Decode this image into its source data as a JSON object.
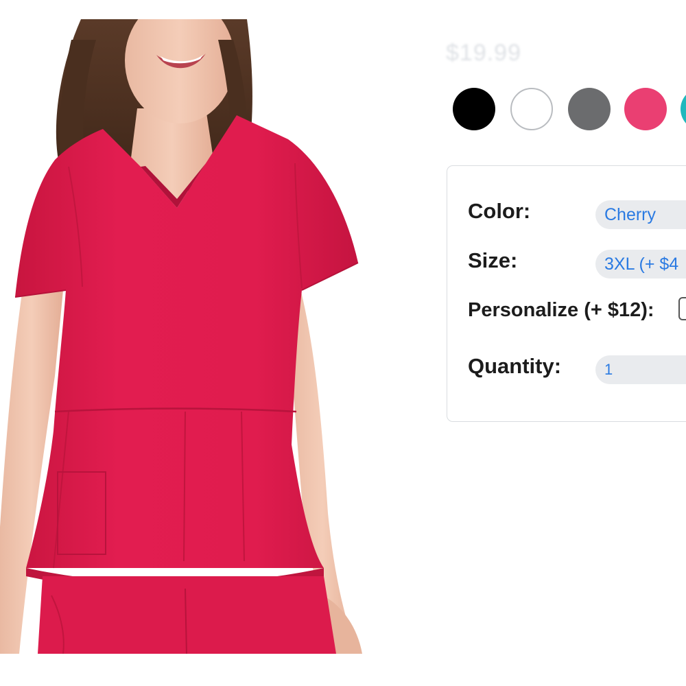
{
  "product": {
    "price": "$19.99",
    "swatches": [
      {
        "name": "Black",
        "color": "#000000"
      },
      {
        "name": "White",
        "color": "#ffffff"
      },
      {
        "name": "Gray",
        "color": "#6b6c6e"
      },
      {
        "name": "Pink",
        "color": "#ea3f72"
      },
      {
        "name": "Teal",
        "color": "#1fb8bd"
      }
    ],
    "garment_color": "#df1c4e"
  },
  "options": {
    "color_label": "Color:",
    "color_value": "Cherry",
    "size_label": "Size:",
    "size_value": "3XL (+ $4",
    "personalize_label": "Personalize (+ $12):",
    "quantity_label": "Quantity:",
    "quantity_value": "1"
  }
}
